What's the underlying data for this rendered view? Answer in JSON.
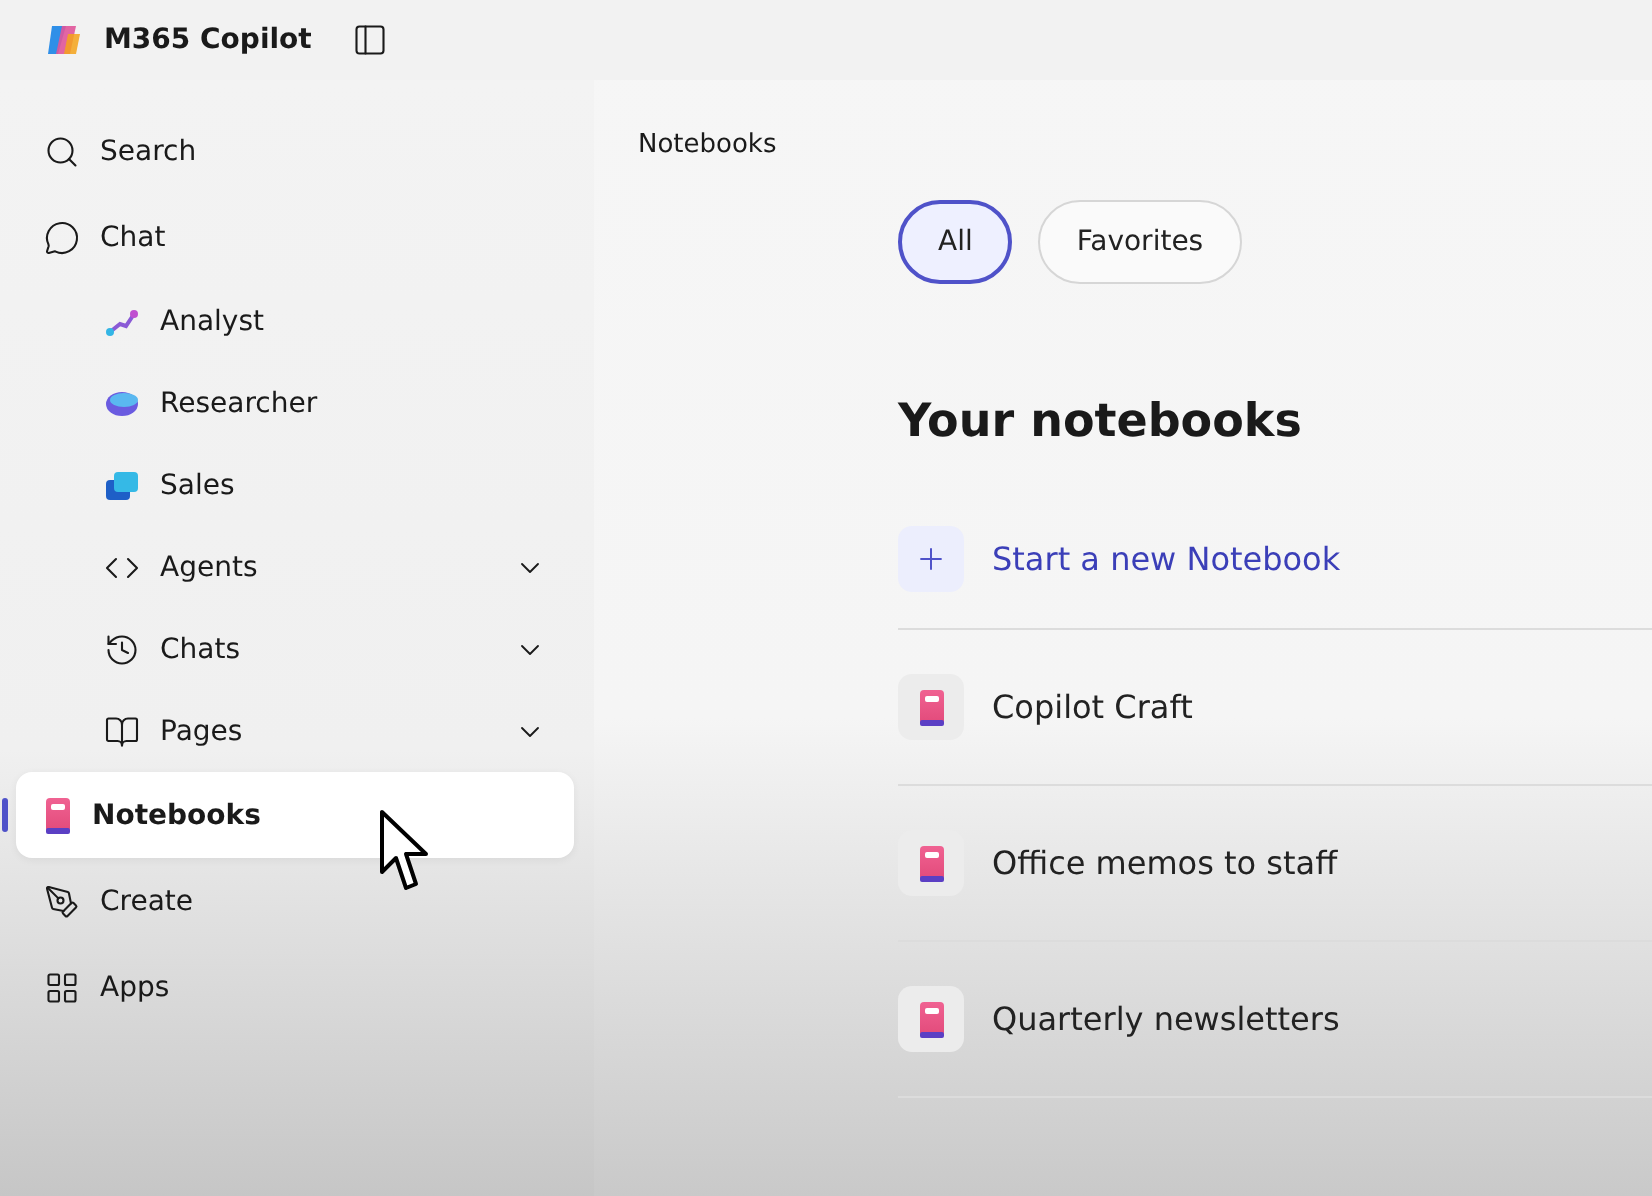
{
  "app": {
    "title": "M365 Copilot"
  },
  "sidebar": {
    "items": [
      {
        "label": "Search",
        "kind": "nav",
        "selected": false
      },
      {
        "label": "Chat",
        "kind": "nav",
        "selected": false,
        "children": [
          {
            "label": "Analyst",
            "kind": "agent",
            "selected": false
          },
          {
            "label": "Researcher",
            "kind": "agent",
            "selected": false
          },
          {
            "label": "Sales",
            "kind": "agent",
            "selected": false
          },
          {
            "label": "Agents",
            "kind": "group",
            "selected": false,
            "expanded": false
          },
          {
            "label": "Chats",
            "kind": "group",
            "selected": false,
            "expanded": false
          },
          {
            "label": "Pages",
            "kind": "group",
            "selected": false,
            "expanded": false
          }
        ]
      },
      {
        "label": "Notebooks",
        "kind": "nav",
        "selected": true
      },
      {
        "label": "Create",
        "kind": "nav",
        "selected": false
      },
      {
        "label": "Apps",
        "kind": "nav",
        "selected": false
      }
    ]
  },
  "main": {
    "breadcrumb": "Notebooks",
    "tabs": [
      {
        "label": "All",
        "selected": true
      },
      {
        "label": "Favorites",
        "selected": false
      }
    ],
    "heading": "Your notebooks",
    "notebooks": [
      {
        "title": "Start a new Notebook",
        "kind": "new"
      },
      {
        "title": "Copilot Craft",
        "kind": "notebook"
      },
      {
        "title": "Office memos to staff",
        "kind": "notebook"
      },
      {
        "title": "Quarterly newsletters",
        "kind": "notebook"
      }
    ]
  }
}
